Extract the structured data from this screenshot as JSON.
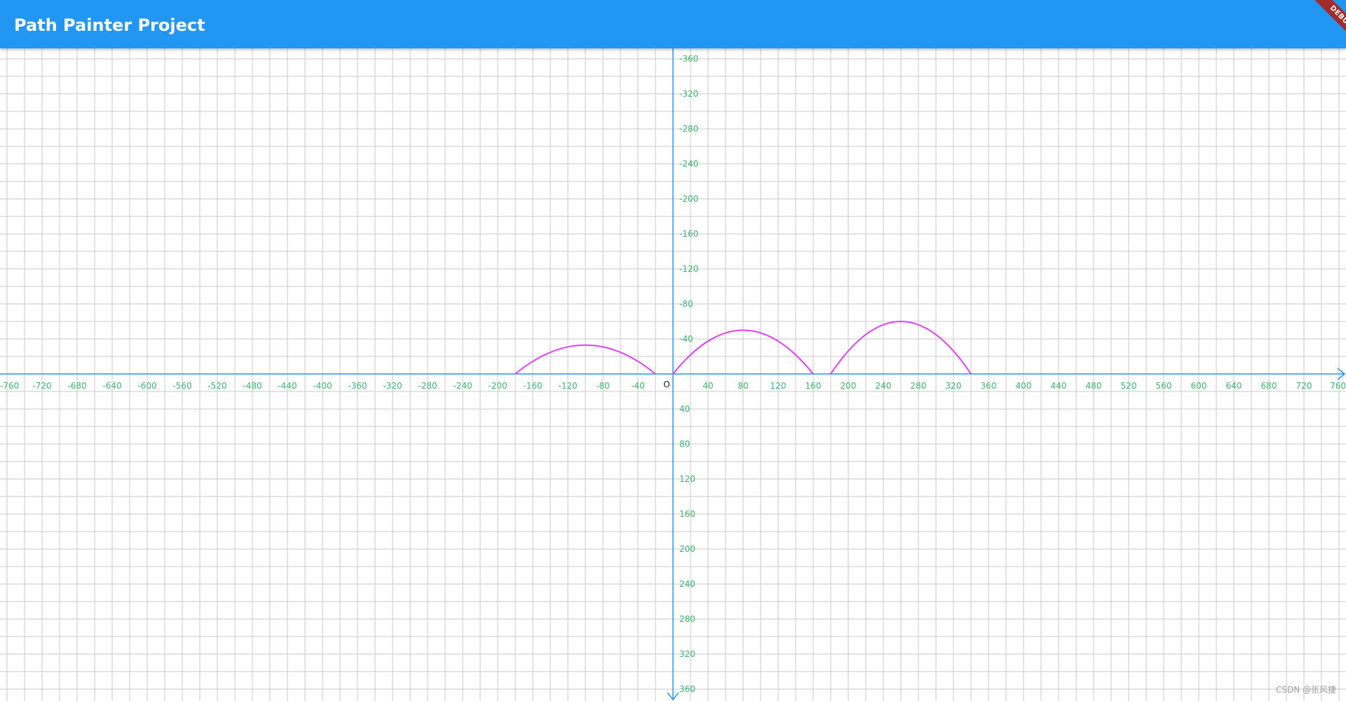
{
  "app": {
    "title": "Path Painter Project",
    "debug_banner": "DEBUG",
    "bar_color": "#2196F3",
    "banner_color": "#A22B2B"
  },
  "plot": {
    "x_ticks": [
      "-760",
      "-720",
      "-680",
      "-640",
      "-600",
      "-560",
      "-520",
      "-480",
      "-440",
      "-400",
      "-360",
      "-320",
      "-280",
      "-240",
      "-200",
      "-160",
      "-120",
      "-80",
      "-40",
      "40",
      "80",
      "120",
      "160",
      "200",
      "240",
      "280",
      "320",
      "360",
      "400",
      "440",
      "480",
      "520",
      "560",
      "600",
      "640",
      "680",
      "720",
      "760"
    ],
    "y_ticks": [
      "-360",
      "-320",
      "-280",
      "-240",
      "-200",
      "-160",
      "-120",
      "-80",
      "-40",
      "40",
      "80",
      "120",
      "160",
      "200",
      "240",
      "280",
      "320",
      "360"
    ],
    "origin_label": "O",
    "axis_color": "#2196F3",
    "grid_color": "#c8c8c8",
    "tick_color": "#3cb371",
    "curve_color": "#e040fb",
    "arcs": [
      {
        "x_start": -180,
        "x_end": -20,
        "peak_x": -100,
        "peak_y": -33
      },
      {
        "x_start": 0,
        "x_end": 160,
        "peak_x": 80,
        "peak_y": -50
      },
      {
        "x_start": 180,
        "x_end": 340,
        "peak_x": 260,
        "peak_y": -60
      }
    ]
  },
  "watermark": "CSDN @张风捷"
}
